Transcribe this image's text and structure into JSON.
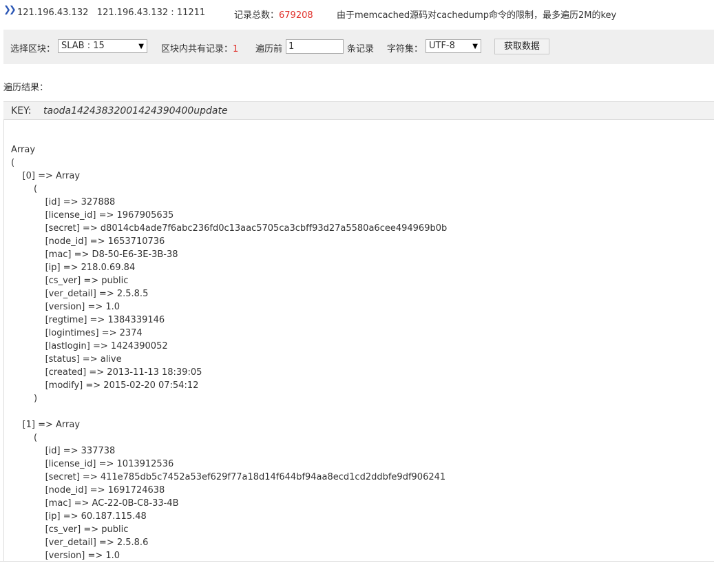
{
  "header": {
    "host": "121.196.43.132",
    "host_port": "121.196.43.132 : 11211",
    "total_label": "记录总数：",
    "total_value": "679208",
    "note": "由于memcached源码对cachedump命令的限制，最多遍历2M的key"
  },
  "toolbar": {
    "slab_label": "选择区块：",
    "slab_value": "SLAB : 15",
    "block_count_label": "区块内共有记录：",
    "block_count_value": "1",
    "iterate_label": "遍历前",
    "iterate_value": "1",
    "iterate_suffix": "条记录",
    "charset_label": "字符集：",
    "charset_value": "UTF-8",
    "fetch_button": "获取数据"
  },
  "result": {
    "label": "遍历结果：",
    "key_label": "KEY:",
    "key_value": "taoda14243832001424390400update"
  },
  "dump_lines": [
    "Array",
    "(",
    "    [0] => Array",
    "        (",
    "            [id] => 327888",
    "            [license_id] => 1967905635",
    "            [secret] => d8014cb4ade7f6abc236fd0c13aac5705ca3cbff93d27a5580a6cee494969b0b",
    "            [node_id] => 1653710736",
    "            [mac] => D8-50-E6-3E-3B-38",
    "            [ip] => 218.0.69.84",
    "            [cs_ver] => public",
    "            [ver_detail] => 2.5.8.5",
    "            [version] => 1.0",
    "            [regtime] => 1384339146",
    "            [logintimes] => 2374",
    "            [lastlogin] => 1424390052",
    "            [status] => alive",
    "            [created] => 2013-11-13 18:39:05",
    "            [modify] => 2015-02-20 07:54:12",
    "        )",
    "",
    "    [1] => Array",
    "        (",
    "            [id] => 337738",
    "            [license_id] => 1013912536",
    "            [secret] => 411e785db5c7452a53ef629f77a18d14f644bf94aa8ecd1cd2ddbfe9df906241",
    "            [node_id] => 1691724638",
    "            [mac] => AC-22-0B-C8-33-4B",
    "            [ip] => 60.187.115.48",
    "            [cs_ver] => public",
    "            [ver_detail] => 2.5.8.6",
    "            [version] => 1.0"
  ],
  "icons": {
    "header_marker": "double-chevron-right-icon",
    "select_caret": "chevron-down-icon"
  }
}
